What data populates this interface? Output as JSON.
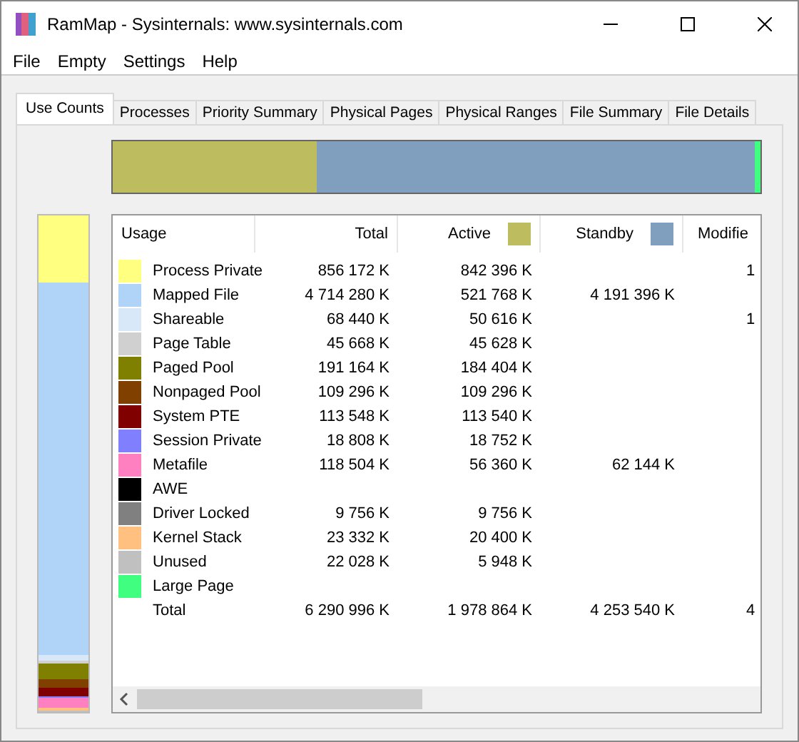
{
  "window": {
    "title": "RamMap - Sysinternals: www.sysinternals.com"
  },
  "menu": [
    "File",
    "Empty",
    "Settings",
    "Help"
  ],
  "tabs": [
    {
      "label": "Use Counts",
      "selected": true
    },
    {
      "label": "Processes",
      "selected": false
    },
    {
      "label": "Priority Summary",
      "selected": false
    },
    {
      "label": "Physical Pages",
      "selected": false
    },
    {
      "label": "Physical Ranges",
      "selected": false
    },
    {
      "label": "File Summary",
      "selected": false
    },
    {
      "label": "File Details",
      "selected": false
    }
  ],
  "table": {
    "columns": [
      {
        "label": "Usage"
      },
      {
        "label": "Total"
      },
      {
        "label": "Active",
        "color": "#bdbd60"
      },
      {
        "label": "Standby",
        "color": "#809fbf"
      },
      {
        "label": "Modifie"
      }
    ],
    "rows": [
      {
        "usage": "Process Private",
        "color": "#ffff80",
        "total": "856 172 K",
        "active": "842 396 K",
        "standby": "",
        "modified": "1"
      },
      {
        "usage": "Mapped File",
        "color": "#b0d4f8",
        "total": "4 714 280 K",
        "active": "521 768 K",
        "standby": "4 191 396 K",
        "modified": ""
      },
      {
        "usage": "Shareable",
        "color": "#d8e8f8",
        "total": "68 440 K",
        "active": "50 616 K",
        "standby": "",
        "modified": "1"
      },
      {
        "usage": "Page Table",
        "color": "#d0d0d0",
        "total": "45 668 K",
        "active": "45 628 K",
        "standby": "",
        "modified": ""
      },
      {
        "usage": "Paged Pool",
        "color": "#808000",
        "total": "191 164 K",
        "active": "184 404 K",
        "standby": "",
        "modified": ""
      },
      {
        "usage": "Nonpaged Pool",
        "color": "#804000",
        "total": "109 296 K",
        "active": "109 296 K",
        "standby": "",
        "modified": ""
      },
      {
        "usage": "System PTE",
        "color": "#800000",
        "total": "113 548 K",
        "active": "113 540 K",
        "standby": "",
        "modified": ""
      },
      {
        "usage": "Session Private",
        "color": "#8080ff",
        "total": "18 808 K",
        "active": "18 752 K",
        "standby": "",
        "modified": ""
      },
      {
        "usage": "Metafile",
        "color": "#ff80c0",
        "total": "118 504 K",
        "active": "56 360 K",
        "standby": "62 144 K",
        "modified": ""
      },
      {
        "usage": "AWE",
        "color": "#000000",
        "total": "",
        "active": "",
        "standby": "",
        "modified": ""
      },
      {
        "usage": "Driver Locked",
        "color": "#808080",
        "total": "9 756 K",
        "active": "9 756 K",
        "standby": "",
        "modified": ""
      },
      {
        "usage": "Kernel Stack",
        "color": "#ffc080",
        "total": "23 332 K",
        "active": "20 400 K",
        "standby": "",
        "modified": ""
      },
      {
        "usage": "Unused",
        "color": "#c0c0c0",
        "total": "22 028 K",
        "active": "5 948 K",
        "standby": "",
        "modified": ""
      },
      {
        "usage": "Large Page",
        "color": "#40ff80",
        "total": "",
        "active": "",
        "standby": "",
        "modified": ""
      }
    ],
    "total_row": {
      "usage": "Total",
      "total": "6 290 996 K",
      "active": "1 978 864 K",
      "standby": "4 253 540 K",
      "modified": "4"
    }
  }
}
